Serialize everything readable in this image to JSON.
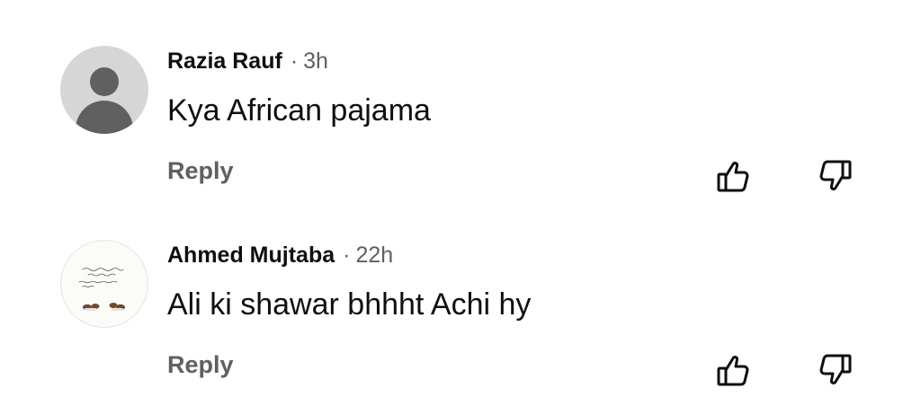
{
  "comments": [
    {
      "author": "Razia Rauf",
      "separator": "·",
      "time": "3h",
      "text": "Kya African pajama",
      "reply_label": "Reply",
      "avatar": "default-person-icon"
    },
    {
      "author": "Ahmed Mujtaba",
      "separator": "·",
      "time": "22h",
      "text": "Ali ki shawar bhhht Achi hy",
      "reply_label": "Reply",
      "avatar": "calligraphy-profile-picture"
    }
  ],
  "icons": {
    "like": "thumbs-up-outline-icon",
    "dislike": "thumbs-down-outline-icon"
  },
  "colors": {
    "text_primary": "#0f0f0f",
    "text_secondary": "#606060",
    "avatar_bg": "#d6d6d6",
    "avatar_fg": "#606060"
  }
}
